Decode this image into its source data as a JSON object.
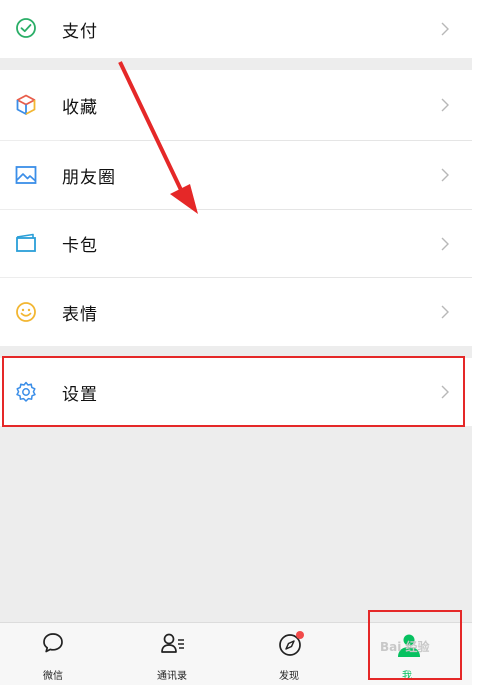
{
  "menu": {
    "pay": "支付",
    "favorites": "收藏",
    "moments": "朋友圈",
    "cards": "卡包",
    "stickers": "表情",
    "settings": "设置"
  },
  "tabs": [
    {
      "label": "微信"
    },
    {
      "label": "通讯录"
    },
    {
      "label": "发现"
    },
    {
      "label": "我"
    }
  ],
  "watermark": "Bai 经验",
  "colors": {
    "accent_green": "#07c160",
    "annotation_red": "#e52828",
    "badge_red": "#f24a4a"
  }
}
